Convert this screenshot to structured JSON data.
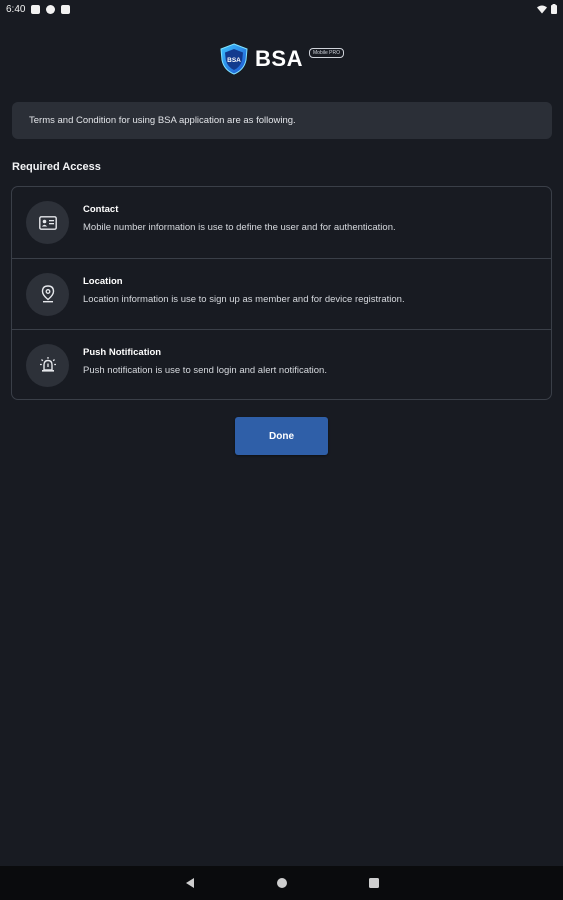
{
  "status_bar": {
    "time": "6:40",
    "icons": [
      "notification-icon",
      "app-icon",
      "sim-icon",
      "wifi-icon",
      "battery-icon"
    ]
  },
  "logo": {
    "name": "BSA",
    "tag": "Mobile PRO"
  },
  "terms": {
    "text": "Terms and Condition for using BSA application are as following."
  },
  "required_access": {
    "title": "Required Access",
    "items": [
      {
        "icon": "contact-card-icon",
        "title": "Contact",
        "description": "Mobile number information is use to define the user and for authentication."
      },
      {
        "icon": "location-pin-icon",
        "title": "Location",
        "description": "Location information is use to sign up as member and for device registration."
      },
      {
        "icon": "alarm-bell-icon",
        "title": "Push Notification",
        "description": "Push notification is use to send login and alert notification."
      }
    ]
  },
  "done_button": {
    "label": "Done"
  },
  "colors": {
    "background": "#181b22",
    "card_border": "#3a3f48",
    "primary_button": "#2f5fa8"
  }
}
